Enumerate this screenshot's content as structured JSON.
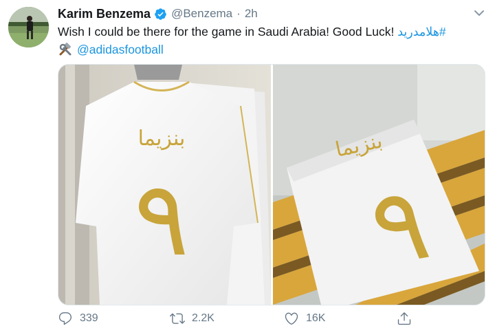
{
  "tweet": {
    "author_name": "Karim Benzema",
    "handle": "@Benzema",
    "separator": "·",
    "time": "2h",
    "text_line1": "Wish I could be there for the game in Saudi Arabia! Good Luck!",
    "hashtag": "#هلامدريد",
    "mention": "@adidasfootball",
    "jersey_name": "بنزيما",
    "jersey_number": "٩"
  },
  "actions": {
    "replies": "339",
    "retweets": "2.2K",
    "likes": "16K"
  },
  "icons": {
    "verified": "verified-badge-icon",
    "caret": "chevron-down-icon",
    "emoji": "hammer-and-wrench-emoji",
    "reply": "reply-icon",
    "retweet": "retweet-icon",
    "like": "heart-icon",
    "share": "share-icon"
  },
  "colors": {
    "link": "#1b95e0",
    "verified": "#1da1f2",
    "muted": "#657786",
    "gold": "#c8a43a"
  }
}
